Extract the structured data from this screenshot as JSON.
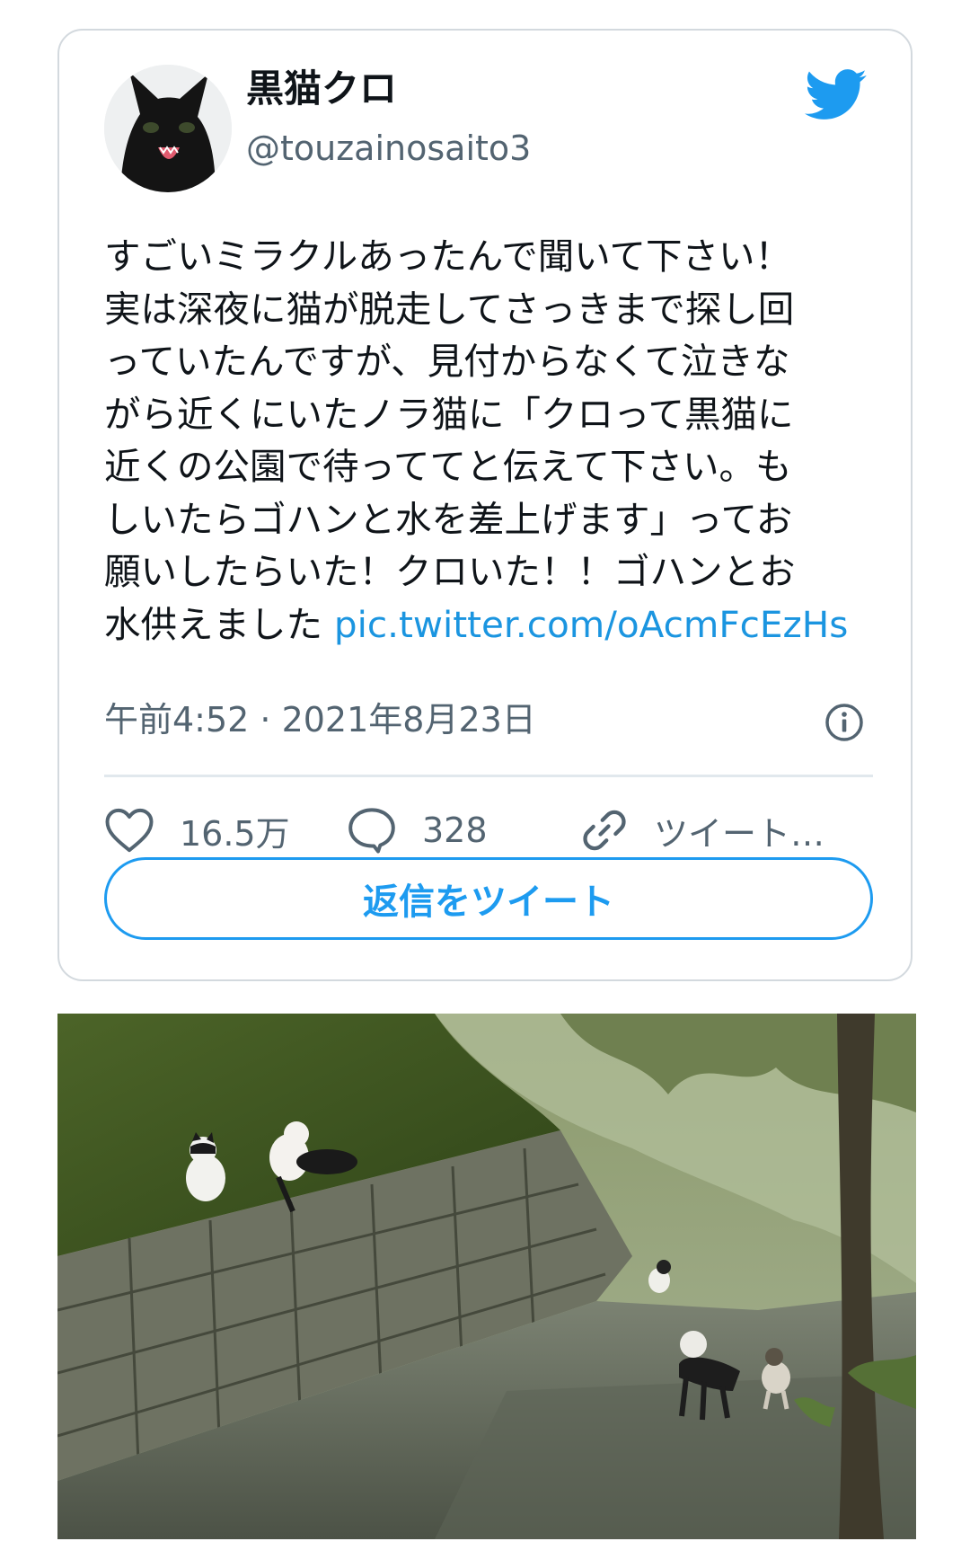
{
  "tweet": {
    "author": {
      "display_name": "黒猫クロ",
      "handle": "@touzainosaito3",
      "avatar_icon": "black-cat-avatar"
    },
    "logo_icon": "twitter-bird-icon",
    "text_lines": [
      "すごいミラクルあったんで聞いて下さい！",
      "実は深夜に猫が脱走してさっきまで探し回",
      "っていたんですが、見付からなくて泣きな",
      "がら近くにいたノラ猫に「クロって黒猫に",
      "近くの公園で待っててと伝えて下さい。も",
      "しいたらゴハンと水を差上げます」ってお",
      "願いしたらいた！クロいた！！ゴハンとお"
    ],
    "last_line_text": "水供えました",
    "link_text": "pic.twitter.com/oAcmFcEzHs",
    "timestamp": "午前4:52 · 2021年8月23日",
    "actions": {
      "like_count": "16.5万",
      "reply_count": "328",
      "copy_link_label": "ツイート…"
    },
    "reply_button_label": "返信をツイート"
  },
  "colors": {
    "link": "#1b95e0",
    "twitter_blue": "#1d9bf0",
    "secondary_text": "#536471",
    "border": "#d3d9de"
  },
  "photo": {
    "description_icon": "cats-on-stone-wall-photo"
  }
}
